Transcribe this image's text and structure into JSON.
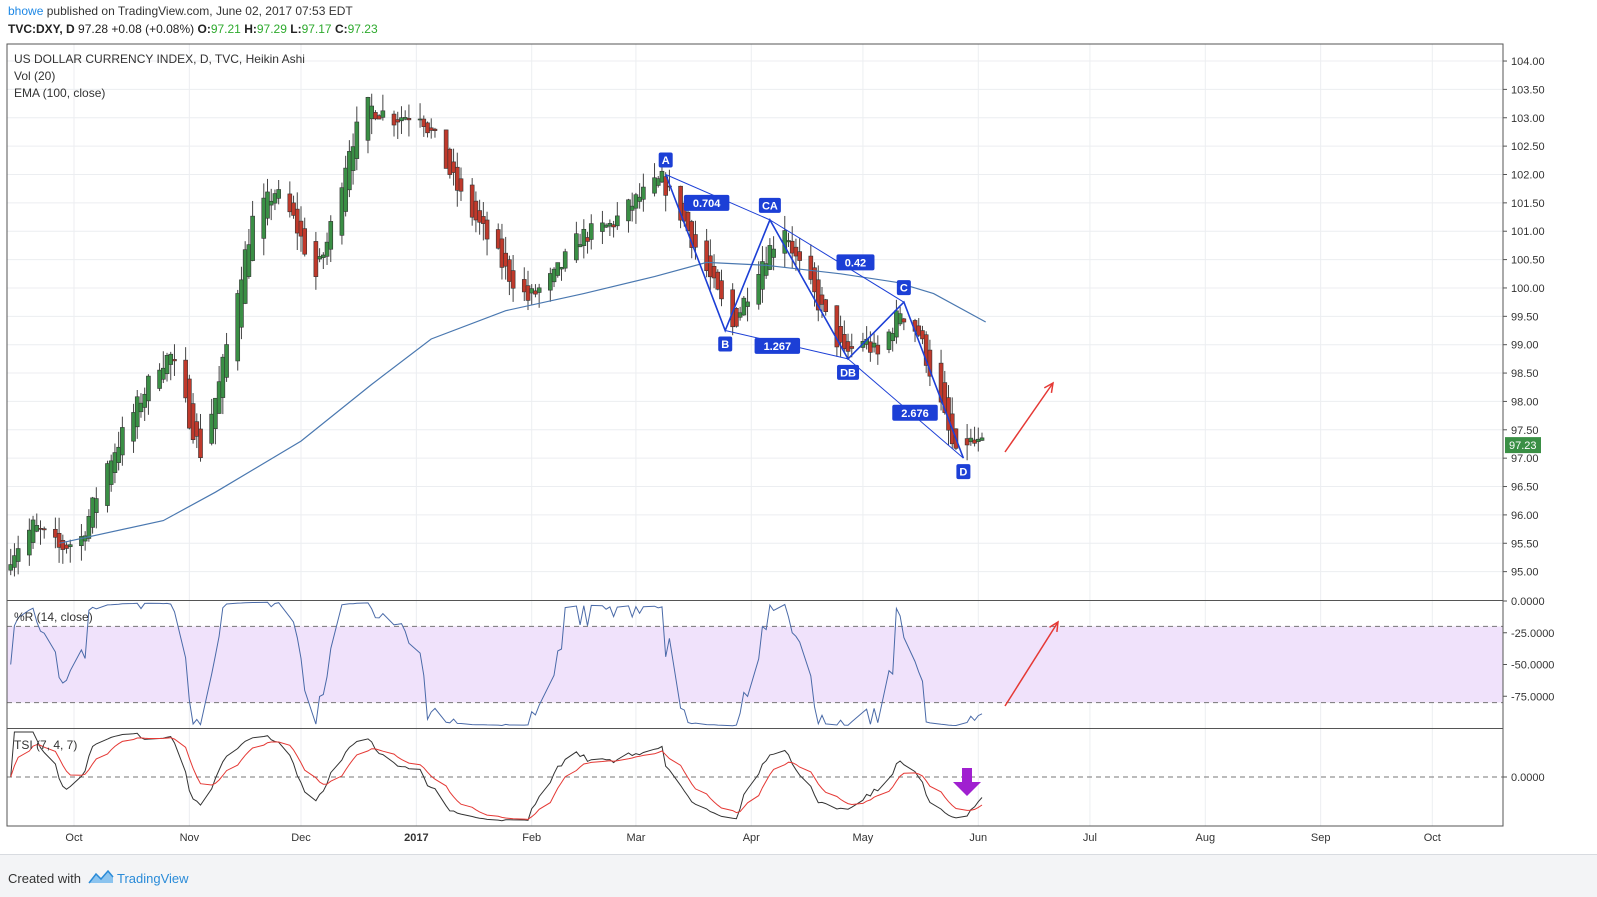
{
  "header": {
    "author": "bhowe",
    "published_text": "published on TradingView.com, June 02, 2017 07:53 EDT",
    "symbol": "TVC:DXY, D",
    "last": "97.28",
    "change": "+0.08 (+0.08%)",
    "o_label": "O:",
    "o": "97.21",
    "h_label": "H:",
    "h": "97.29",
    "l_label": "L:",
    "l": "97.17",
    "c_label": "C:",
    "c": "97.23"
  },
  "footer": {
    "created_with": "Created with",
    "brand": "TradingView"
  },
  "colors": {
    "up": "#3a8f45",
    "down": "#c0392b",
    "ema": "#4a78b0",
    "pattern": "#1c3fd6",
    "arrow": "#e53935",
    "tsi_signal": "#e53935",
    "tsi": "#333333",
    "wr_band": "#f0e2fb",
    "purple": "#a020d0"
  },
  "chart_data": [
    {
      "type": "candlestick",
      "title": "US DOLLAR CURRENCY INDEX, D, TVC, Heikin Ashi",
      "legend": [
        "Vol (20)",
        "EMA (100, close)"
      ],
      "ylim": [
        94.5,
        104.3
      ],
      "y_ticks": [
        "104.00",
        "103.50",
        "103.00",
        "102.50",
        "102.00",
        "101.50",
        "101.00",
        "100.50",
        "100.00",
        "99.50",
        "99.00",
        "98.50",
        "98.00",
        "97.50",
        "97.00",
        "96.50",
        "96.00",
        "95.50",
        "95.00"
      ],
      "last_price_label": "97.23",
      "x_ticks": [
        "Oct",
        "Nov",
        "Dec",
        "2017",
        "Feb",
        "Mar",
        "Apr",
        "May",
        "Jun",
        "Jul",
        "Aug",
        "Sep",
        "Oct"
      ],
      "x_range": [
        "2016-09-13",
        "2017-10-20"
      ],
      "price_path": [
        [
          "2016-09-14",
          95.3
        ],
        [
          "2016-09-20",
          95.8
        ],
        [
          "2016-09-27",
          95.4
        ],
        [
          "2016-10-03",
          95.6
        ],
        [
          "2016-10-10",
          96.9
        ],
        [
          "2016-10-17",
          97.8
        ],
        [
          "2016-10-24",
          98.7
        ],
        [
          "2016-10-27",
          98.8
        ],
        [
          "2016-11-01",
          97.7
        ],
        [
          "2016-11-04",
          97.1
        ],
        [
          "2016-11-09",
          98.3
        ],
        [
          "2016-11-14",
          100.0
        ],
        [
          "2016-11-18",
          101.2
        ],
        [
          "2016-11-24",
          101.7
        ],
        [
          "2016-11-29",
          101.2
        ],
        [
          "2016-12-05",
          100.2
        ],
        [
          "2016-12-08",
          100.8
        ],
        [
          "2016-12-14",
          102.5
        ],
        [
          "2016-12-19",
          103.2
        ],
        [
          "2016-12-26",
          103.0
        ],
        [
          "2017-01-02",
          103.1
        ],
        [
          "2017-01-06",
          102.6
        ],
        [
          "2017-01-13",
          101.6
        ],
        [
          "2017-01-19",
          101.0
        ],
        [
          "2017-01-25",
          100.3
        ],
        [
          "2017-01-31",
          99.8
        ],
        [
          "2017-02-07",
          100.2
        ],
        [
          "2017-02-14",
          100.9
        ],
        [
          "2017-02-22",
          101.1
        ],
        [
          "2017-03-02",
          101.6
        ],
        [
          "2017-03-08",
          101.9
        ],
        [
          "2017-03-13",
          101.3
        ],
        [
          "2017-03-20",
          100.3
        ],
        [
          "2017-03-27",
          99.3
        ],
        [
          "2017-04-03",
          100.4
        ],
        [
          "2017-04-10",
          101.1
        ],
        [
          "2017-04-13",
          100.5
        ],
        [
          "2017-04-20",
          99.6
        ],
        [
          "2017-04-26",
          98.8
        ],
        [
          "2017-05-01",
          99.1
        ],
        [
          "2017-05-05",
          98.8
        ],
        [
          "2017-05-11",
          99.6
        ],
        [
          "2017-05-16",
          99.2
        ],
        [
          "2017-05-22",
          97.9
        ],
        [
          "2017-05-26",
          97.0
        ],
        [
          "2017-05-29",
          97.3
        ],
        [
          "2017-06-02",
          97.2
        ]
      ],
      "ema_100": [
        [
          "2016-09-27",
          95.5
        ],
        [
          "2016-10-25",
          95.9
        ],
        [
          "2016-11-08",
          96.4
        ],
        [
          "2016-12-01",
          97.3
        ],
        [
          "2016-12-20",
          98.3
        ],
        [
          "2017-01-05",
          99.1
        ],
        [
          "2017-01-25",
          99.6
        ],
        [
          "2017-02-15",
          99.9
        ],
        [
          "2017-03-06",
          100.2
        ],
        [
          "2017-03-20",
          100.45
        ],
        [
          "2017-04-05",
          100.4
        ],
        [
          "2017-04-25",
          100.25
        ],
        [
          "2017-05-10",
          100.1
        ],
        [
          "2017-05-20",
          99.9
        ],
        [
          "2017-06-03",
          99.4
        ]
      ],
      "pattern_points": [
        {
          "label": "A",
          "date": "2017-03-09",
          "price": 102.0
        },
        {
          "label": "B",
          "date": "2017-03-25",
          "price": 99.25
        },
        {
          "label": "CA",
          "date": "2017-04-06",
          "price": 101.2
        },
        {
          "label": "DB",
          "date": "2017-04-27",
          "price": 98.75
        },
        {
          "label": "C",
          "date": "2017-05-12",
          "price": 99.75
        },
        {
          "label": "D",
          "date": "2017-05-28",
          "price": 97.0
        }
      ],
      "ratios": [
        {
          "label": "0.704",
          "date": "2017-03-20",
          "price": 101.5
        },
        {
          "label": "1.267",
          "date": "2017-04-08",
          "price": 98.98
        },
        {
          "label": "0.42",
          "date": "2017-04-29",
          "price": 100.45
        },
        {
          "label": "2.676",
          "date": "2017-05-15",
          "price": 97.8
        }
      ]
    },
    {
      "type": "line",
      "title": "%R (14, close)",
      "ylim": [
        -100,
        0
      ],
      "y_ticks": [
        "0.0000",
        "-25.0000",
        "-50.0000",
        "-75.0000"
      ],
      "band": [
        -20,
        -80
      ]
    },
    {
      "type": "line",
      "title": "TSI (7, 4, 7)",
      "y_ticks": [
        "0.0000"
      ],
      "zero_line": 0
    }
  ]
}
